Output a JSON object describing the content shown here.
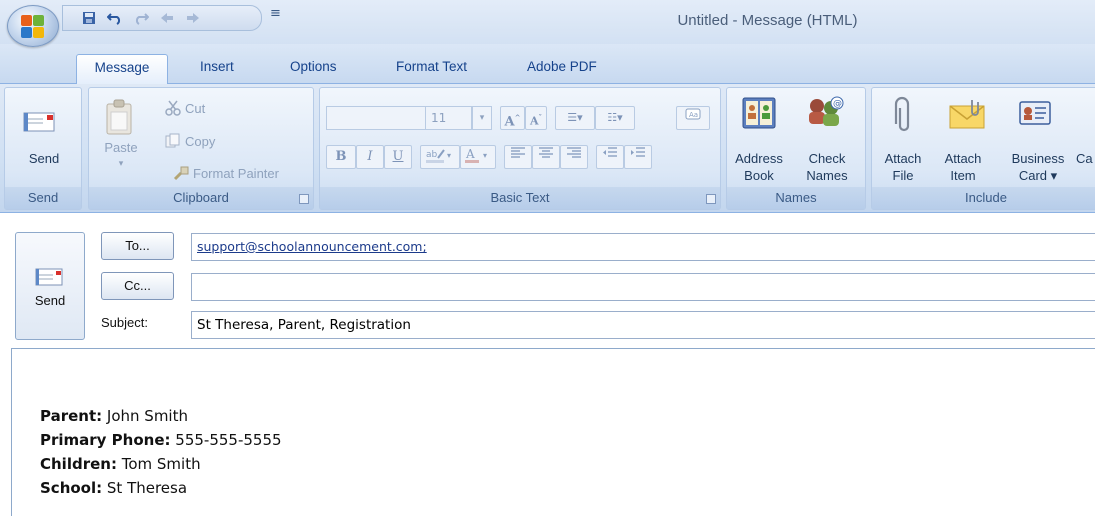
{
  "window": {
    "title": "Untitled - Message (HTML)"
  },
  "quick_access": {
    "icons": [
      "save-icon",
      "undo-icon",
      "redo-icon",
      "previous-item-icon",
      "next-item-icon",
      "customize-toolbar-icon"
    ],
    "customize_glyph": "≡"
  },
  "tabs": [
    {
      "label": "Message",
      "active": true
    },
    {
      "label": "Insert",
      "active": false
    },
    {
      "label": "Options",
      "active": false
    },
    {
      "label": "Format Text",
      "active": false
    },
    {
      "label": "Adobe PDF",
      "active": false
    }
  ],
  "ribbon": {
    "send": {
      "button_label": "Send",
      "group_label": "Send"
    },
    "clipboard": {
      "paste_label": "Paste",
      "cut_label": "Cut",
      "copy_label": "Copy",
      "format_painter_label": "Format Painter",
      "group_label": "Clipboard"
    },
    "basic_text": {
      "font_name": "",
      "font_size": "11",
      "group_label": "Basic Text",
      "bold": "B",
      "italic": "I",
      "underline": "U"
    },
    "names": {
      "address_book_label_1": "Address",
      "address_book_label_2": "Book",
      "check_names_label_1": "Check",
      "check_names_label_2": "Names",
      "group_label": "Names"
    },
    "include": {
      "attach_file_1": "Attach",
      "attach_file_2": "File",
      "attach_item_1": "Attach",
      "attach_item_2": "Item",
      "business_card_1": "Business",
      "business_card_2": "Card ▾",
      "partial_label": "Ca",
      "group_label": "Include"
    }
  },
  "message": {
    "send_label": "Send",
    "to_button": "To...",
    "cc_button": "Cc...",
    "subject_label": "Subject:",
    "to_value": "support@schoolannouncement.com;",
    "cc_value": "",
    "subject_value": "St Theresa, Parent, Registration",
    "body": [
      {
        "label": "Parent:",
        "value": " John Smith"
      },
      {
        "label": "Primary Phone:",
        "value": " 555-555-5555"
      },
      {
        "label": "Children:",
        "value": " Tom Smith"
      },
      {
        "label": "School:",
        "value": " St Theresa"
      }
    ]
  },
  "colors": {
    "ribbon_bg": "#d0e0f3",
    "accent": "#15428b",
    "group_label_bg": "#b7cdea"
  }
}
